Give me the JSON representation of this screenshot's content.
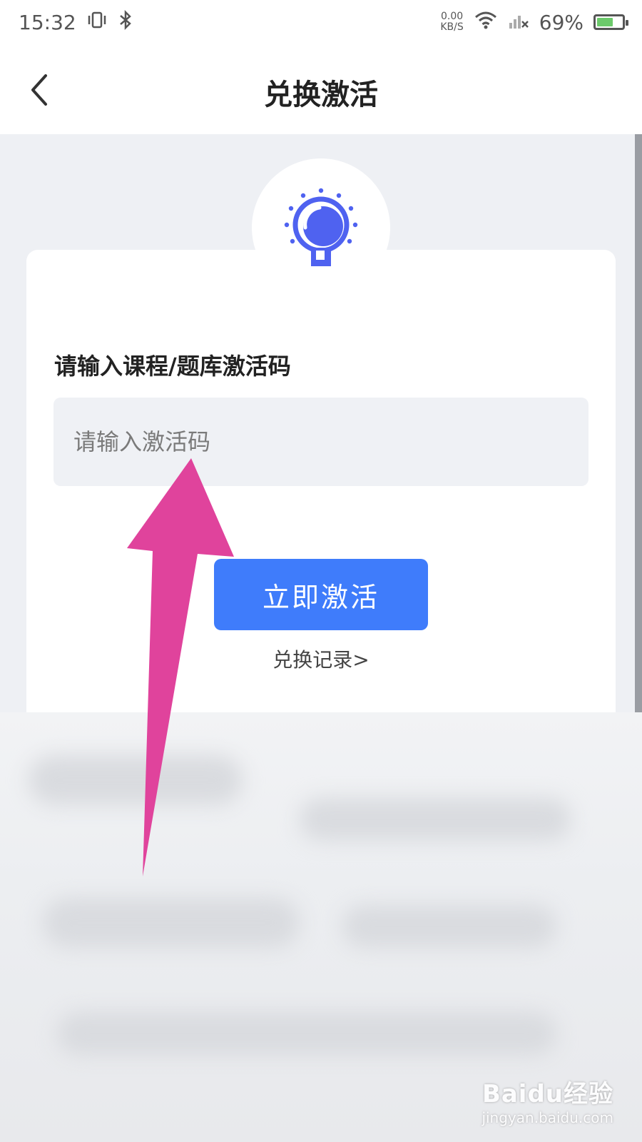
{
  "status_bar": {
    "time": "15:32",
    "net_speed": "0.00",
    "net_unit": "KB/S",
    "battery": "69%",
    "battery_level": 0.69,
    "icons": [
      "vibrate-icon",
      "bluetooth-icon",
      "wifi-icon",
      "signal-icon"
    ]
  },
  "nav": {
    "title": "兑换激活",
    "back_icon": "chevron-left-icon"
  },
  "form": {
    "label": "请输入课程/题库激活码",
    "code_placeholder": "请输入激活码",
    "code_value": "",
    "activate_label": "立即激活",
    "history_link": "兑换记录>"
  },
  "icons": {
    "hero": "lightbulb-icon"
  },
  "colors": {
    "accent": "#3f7cfb",
    "bulb": "#4f62f0",
    "annotation_arrow": "#e0439c",
    "battery": "#6cc96b"
  },
  "watermark": {
    "brand": "Baidu经验",
    "url": "jingyan.baidu.com"
  }
}
